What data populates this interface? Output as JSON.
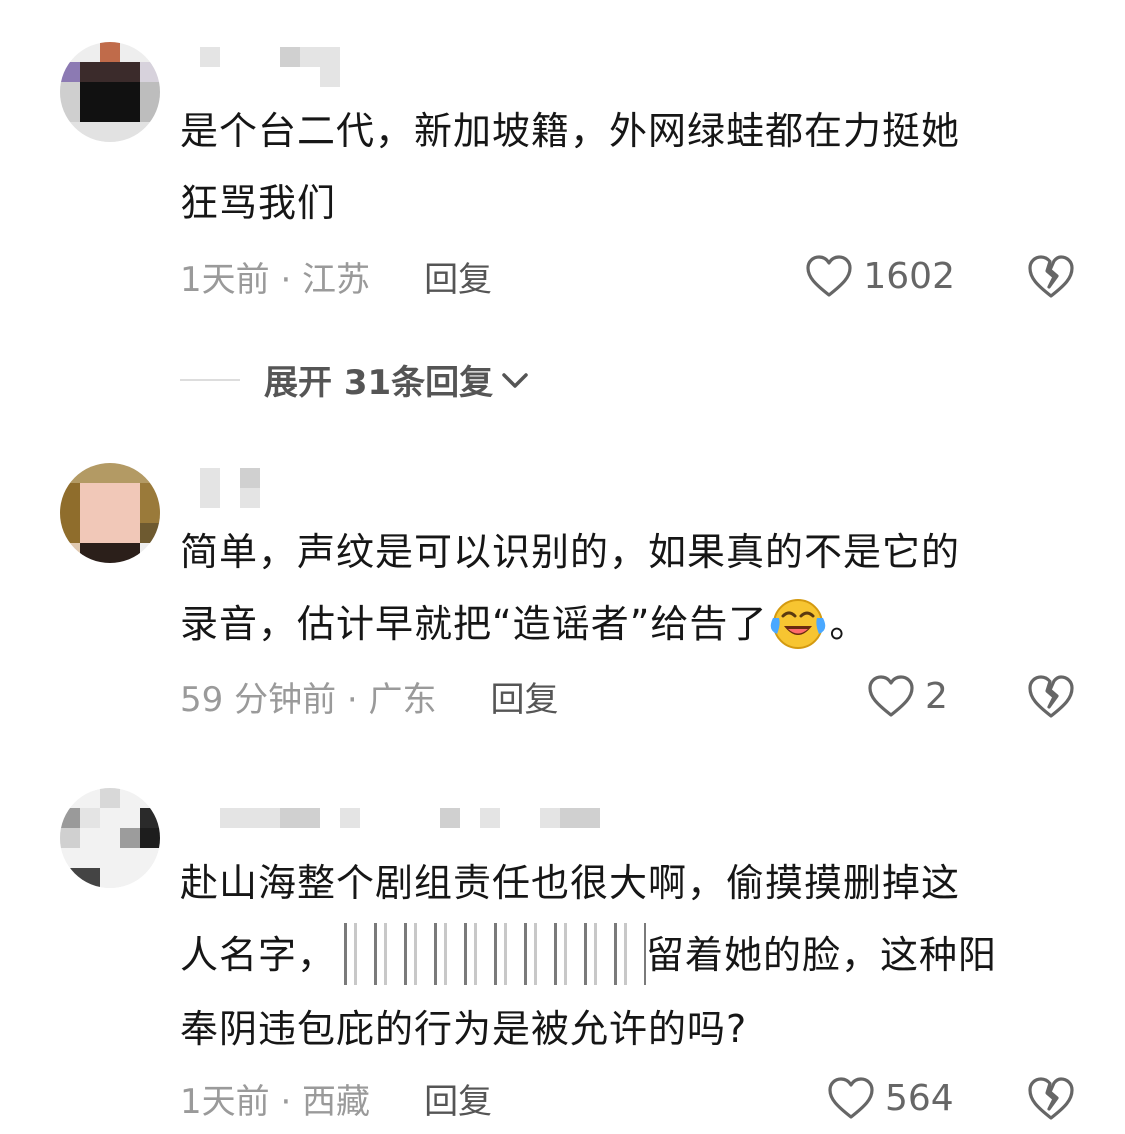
{
  "comments": [
    {
      "text_line1": "是个台二代，新加坡籍，外网绿蛙都在力挺她",
      "text_line2": "狂骂我们",
      "time_location": "1天前 · 江苏",
      "reply_label": "回复",
      "like_count": "1602"
    },
    {
      "text_line1": "简单，声纹是可以识别的，如果真的不是它的",
      "text_line2_a": "录音，估计早就把“造谣者”给告了",
      "text_line2_b": "。",
      "time_location": "59 分钟前 · 广东",
      "reply_label": "回复",
      "like_count": "2"
    },
    {
      "text_line1": "赴山海整个剧组责任也很大啊，偷摸摸删掉这",
      "text_line2_a": "人名字，",
      "text_line2_b": "留着她的脸，这种阳",
      "text_line3": "奉阴违包庇的行为是被允许的吗?",
      "time_location": "1天前 · 西藏",
      "reply_label": "回复",
      "like_count": "564"
    }
  ],
  "expand_replies": {
    "label": "展开 31条回复"
  },
  "icons": {
    "like": "heart-outline-icon",
    "dislike": "broken-heart-icon",
    "expand": "chevron-down-icon",
    "emoji": "laughing-crying-emoji-icon"
  },
  "colors": {
    "text": "#161616",
    "meta": "#9a9a9a",
    "reply": "#555555",
    "icon": "#666666"
  }
}
